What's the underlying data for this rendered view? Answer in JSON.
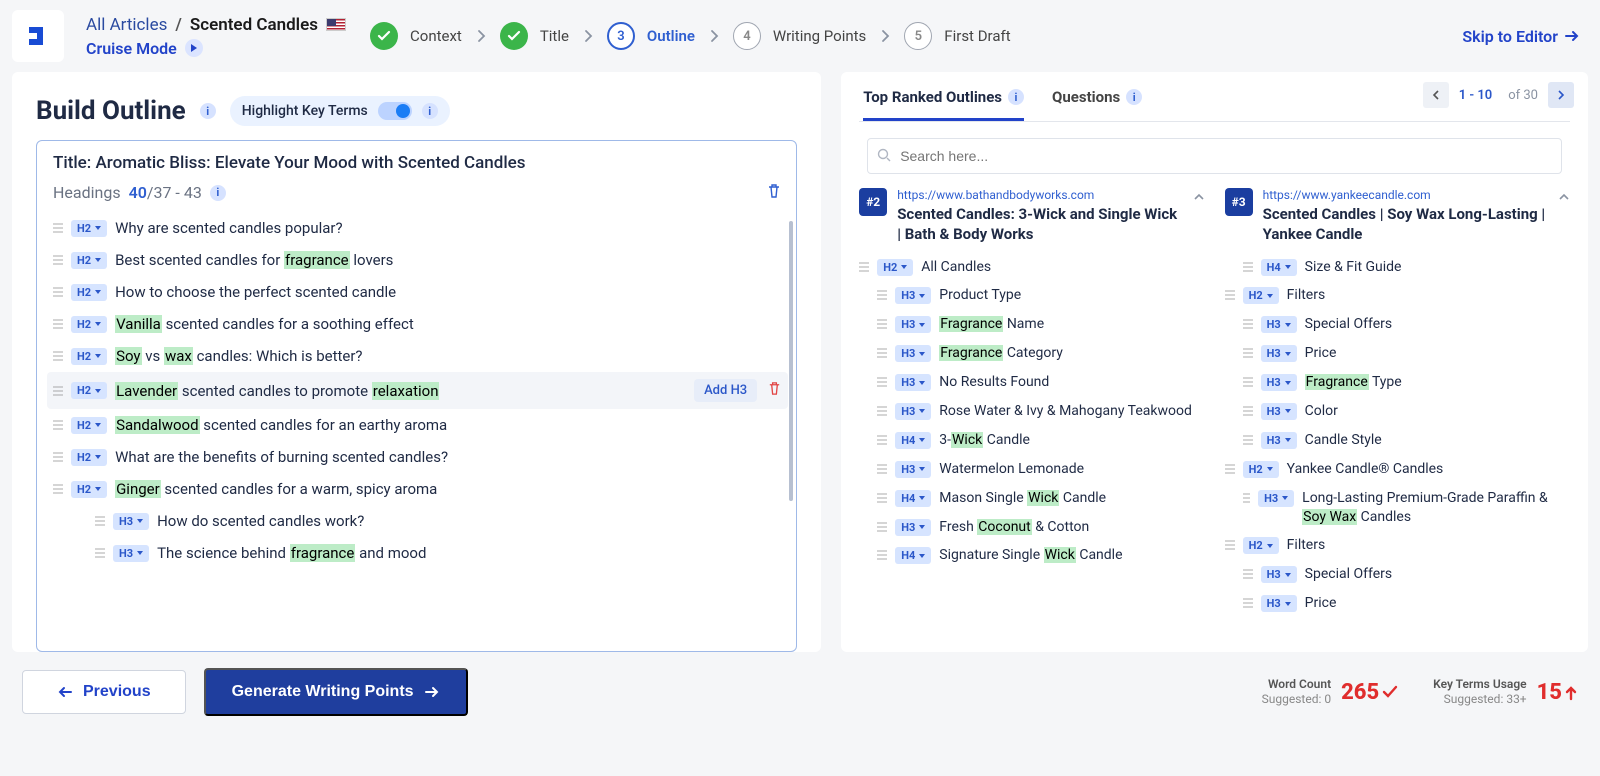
{
  "header": {
    "breadcrumb_root": "All Articles",
    "breadcrumb_current": "Scented Candles",
    "cruise_mode": "Cruise Mode",
    "steps": [
      {
        "label": "Context",
        "state": "done"
      },
      {
        "label": "Title",
        "state": "done"
      },
      {
        "label": "Outline",
        "state": "current",
        "num": "3"
      },
      {
        "label": "Writing Points",
        "state": "pending",
        "num": "4"
      },
      {
        "label": "First Draft",
        "state": "pending",
        "num": "5"
      }
    ],
    "skip": "Skip to Editor"
  },
  "left": {
    "title": "Build Outline",
    "highlight_label": "Highlight Key Terms",
    "article_title": "Title: Aromatic Bliss: Elevate Your Mood with Scented Candles",
    "headings_label": "Headings",
    "heading_count": "40",
    "heading_range": "/37 - 43",
    "add_h3": "Add H3",
    "rows": [
      {
        "tag": "H2",
        "parts": [
          {
            "t": "Why are scented candles popular?"
          }
        ]
      },
      {
        "tag": "H2",
        "parts": [
          {
            "t": "Best scented candles for "
          },
          {
            "t": "fragrance",
            "hl": true
          },
          {
            "t": " lovers"
          }
        ]
      },
      {
        "tag": "H2",
        "parts": [
          {
            "t": "How to choose the perfect scented candle"
          }
        ]
      },
      {
        "tag": "H2",
        "parts": [
          {
            "t": "Vanilla",
            "hl": true
          },
          {
            "t": " scented candles for a soothing effect"
          }
        ]
      },
      {
        "tag": "H2",
        "parts": [
          {
            "t": "Soy",
            "hl": true
          },
          {
            "t": " vs "
          },
          {
            "t": "wax",
            "hl": true
          },
          {
            "t": " candles: Which is better?"
          }
        ]
      },
      {
        "tag": "H2",
        "hovered": true,
        "parts": [
          {
            "t": "Lavender",
            "hl": true
          },
          {
            "t": " scented candles to promote "
          },
          {
            "t": "relaxation",
            "hl": true
          }
        ]
      },
      {
        "tag": "H2",
        "parts": [
          {
            "t": "Sandalwood",
            "hl": true
          },
          {
            "t": " scented candles for an earthy aroma"
          }
        ]
      },
      {
        "tag": "H2",
        "parts": [
          {
            "t": "What are the benefits of burning scented candles?"
          }
        ]
      },
      {
        "tag": "H2",
        "parts": [
          {
            "t": "Ginger",
            "hl": true
          },
          {
            "t": " scented candles for a warm, spicy aroma"
          }
        ]
      },
      {
        "tag": "H3",
        "indent": 1,
        "parts": [
          {
            "t": "How do scented candles work?"
          }
        ]
      },
      {
        "tag": "H3",
        "indent": 1,
        "parts": [
          {
            "t": "The science behind "
          },
          {
            "t": "fragrance",
            "hl": true
          },
          {
            "t": " and mood"
          }
        ]
      }
    ]
  },
  "right": {
    "tabs": {
      "outlines": "Top Ranked Outlines",
      "questions": "Questions"
    },
    "pager": {
      "range": "1 - 10",
      "of": "of 30"
    },
    "search_placeholder": "Search here...",
    "col1": {
      "rank": "#2",
      "url": "https://www.bathandbodyworks.com",
      "title": "Scented Candles: 3-Wick and Single Wick | Bath & Body Works",
      "rows": [
        {
          "tag": "H2",
          "parts": [
            {
              "t": "All Candles"
            }
          ]
        },
        {
          "tag": "H3",
          "parts": [
            {
              "t": "Product Type"
            }
          ]
        },
        {
          "tag": "H3",
          "parts": [
            {
              "t": "Fragrance",
              "hl": true
            },
            {
              "t": " Name"
            }
          ]
        },
        {
          "tag": "H3",
          "parts": [
            {
              "t": "Fragrance",
              "hl": true
            },
            {
              "t": " Category"
            }
          ]
        },
        {
          "tag": "H3",
          "parts": [
            {
              "t": "No Results Found"
            }
          ]
        },
        {
          "tag": "H3",
          "parts": [
            {
              "t": "Rose Water & Ivy & Mahogany Teakwood"
            }
          ]
        },
        {
          "tag": "H4",
          "parts": [
            {
              "t": "3-"
            },
            {
              "t": "Wick",
              "hl": true
            },
            {
              "t": " Candle"
            }
          ]
        },
        {
          "tag": "H3",
          "parts": [
            {
              "t": "Watermelon Lemonade"
            }
          ]
        },
        {
          "tag": "H4",
          "parts": [
            {
              "t": "Mason Single "
            },
            {
              "t": "Wick",
              "hl": true
            },
            {
              "t": " Candle"
            }
          ]
        },
        {
          "tag": "H3",
          "parts": [
            {
              "t": "Fresh "
            },
            {
              "t": "Coconut",
              "hl": true
            },
            {
              "t": " & Cotton"
            }
          ]
        },
        {
          "tag": "H4",
          "parts": [
            {
              "t": "Signature Single "
            },
            {
              "t": "Wick",
              "hl": true
            },
            {
              "t": " Candle"
            }
          ]
        }
      ]
    },
    "col2": {
      "rank": "#3",
      "url": "https://www.yankeecandle.com",
      "title": "Scented Candles | Soy Wax Long-Lasting | Yankee Candle",
      "rows": [
        {
          "tag": "H4",
          "parts": [
            {
              "t": "Size & Fit Guide"
            }
          ]
        },
        {
          "tag": "H2",
          "parts": [
            {
              "t": "Filters"
            }
          ]
        },
        {
          "tag": "H3",
          "parts": [
            {
              "t": "Special Offers"
            }
          ]
        },
        {
          "tag": "H3",
          "parts": [
            {
              "t": "Price"
            }
          ]
        },
        {
          "tag": "H3",
          "parts": [
            {
              "t": "Fragrance",
              "hl": true
            },
            {
              "t": " Type"
            }
          ]
        },
        {
          "tag": "H3",
          "parts": [
            {
              "t": "Color"
            }
          ]
        },
        {
          "tag": "H3",
          "parts": [
            {
              "t": "Candle Style"
            }
          ]
        },
        {
          "tag": "H2",
          "parts": [
            {
              "t": "Yankee Candle® Candles"
            }
          ]
        },
        {
          "tag": "H3",
          "parts": [
            {
              "t": "Long-Lasting Premium-Grade Paraffin & "
            },
            {
              "t": "Soy Wax",
              "hl": true
            },
            {
              "t": " Candles"
            }
          ]
        },
        {
          "tag": "H2",
          "parts": [
            {
              "t": "Filters"
            }
          ]
        },
        {
          "tag": "H3",
          "parts": [
            {
              "t": "Special Offers"
            }
          ]
        },
        {
          "tag": "H3",
          "parts": [
            {
              "t": "Price"
            }
          ]
        }
      ]
    }
  },
  "footer": {
    "prev": "Previous",
    "generate": "Generate Writing Points",
    "wc_label": "Word Count",
    "wc_sub": "Suggested: 0",
    "wc_val": "265",
    "kt_label": "Key Terms Usage",
    "kt_sub": "Suggested: 33+",
    "kt_val": "15"
  }
}
